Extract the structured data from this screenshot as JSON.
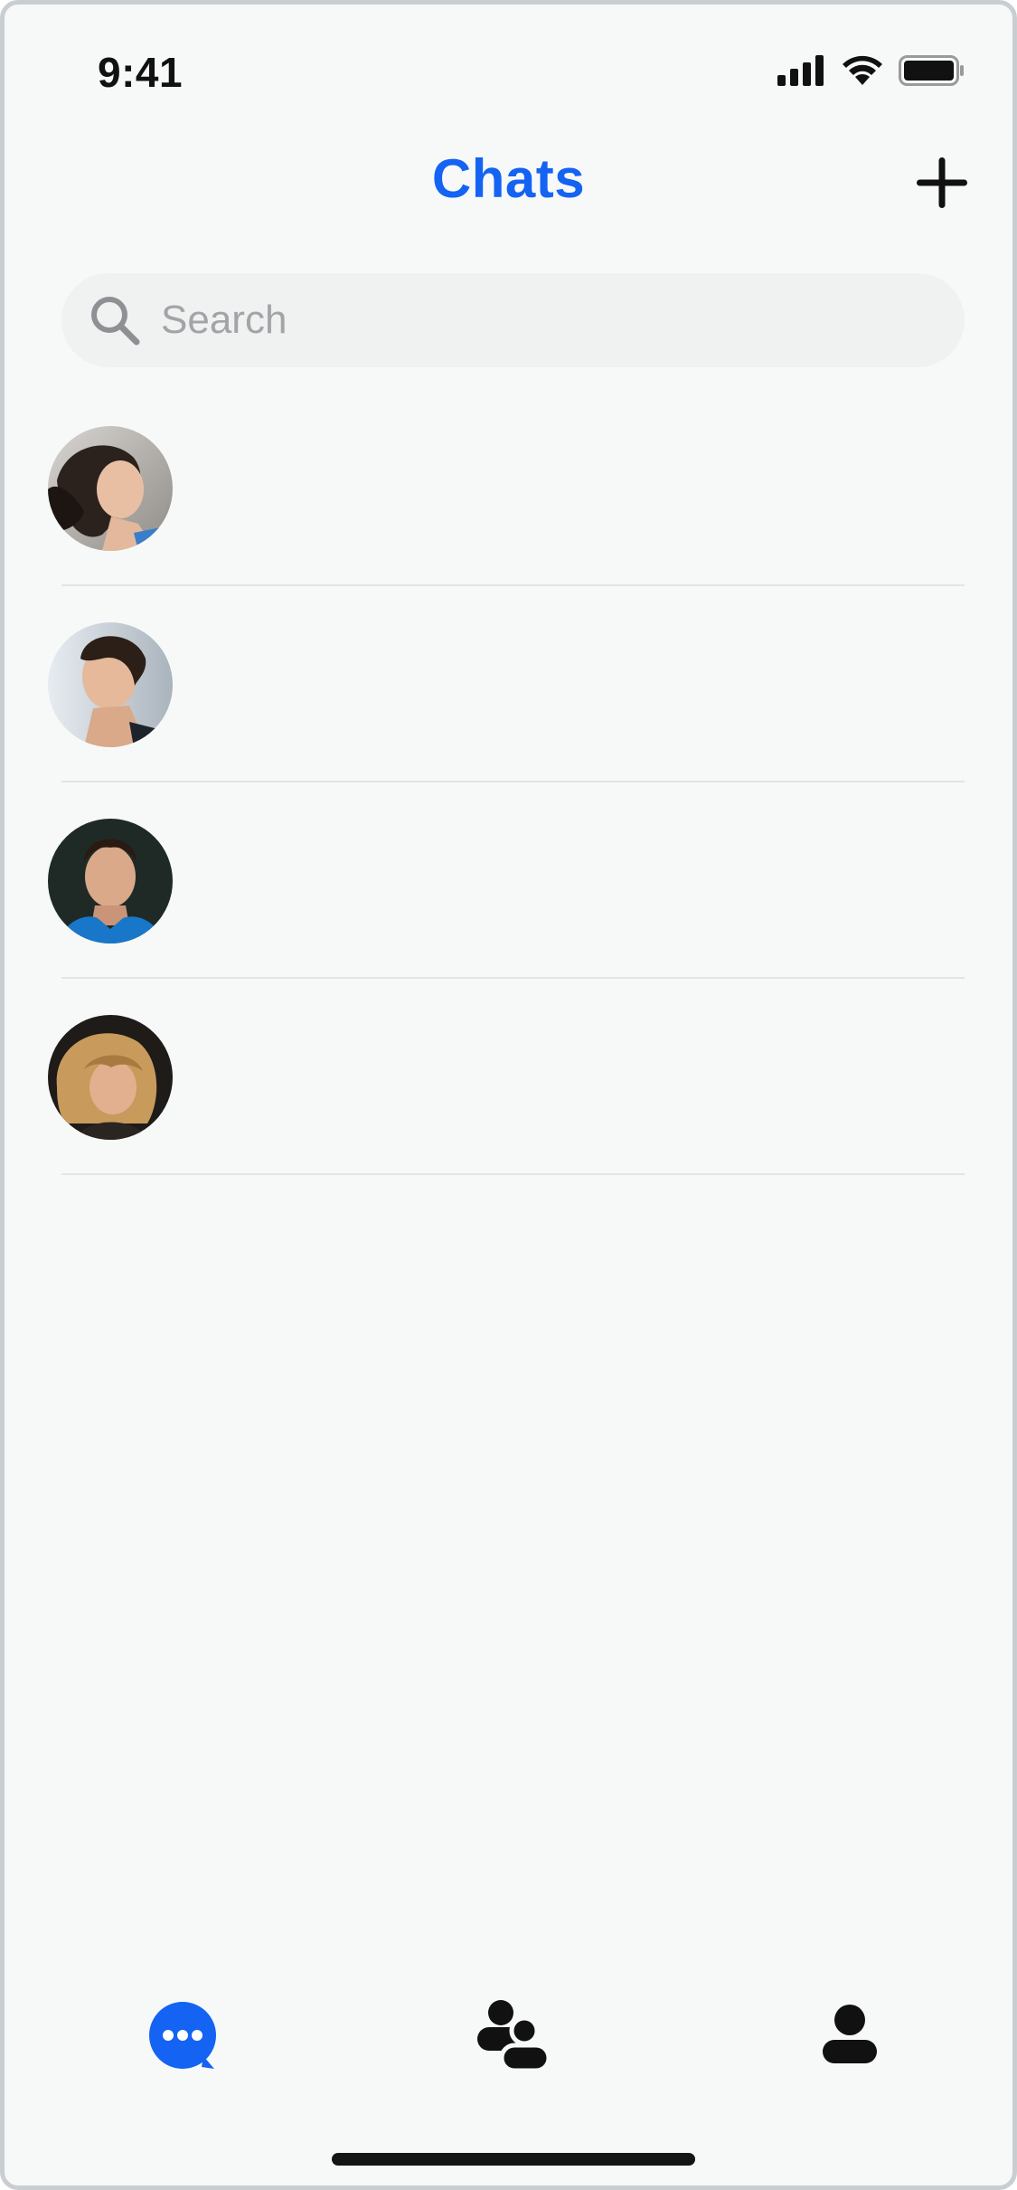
{
  "status_bar": {
    "time": "9:41"
  },
  "header": {
    "title": "Chats",
    "new_chat_icon": "plus-icon"
  },
  "search": {
    "placeholder": "Search",
    "value": "",
    "icon": "search-icon"
  },
  "chats": [
    {
      "avatar": "avatar-woman-dark-hair"
    },
    {
      "avatar": "avatar-man-looking-up"
    },
    {
      "avatar": "avatar-man-blue-jacket"
    },
    {
      "avatar": "avatar-woman-blonde"
    }
  ],
  "tab_bar": {
    "tabs": [
      {
        "icon": "chat-bubble-icon",
        "active": true
      },
      {
        "icon": "contacts-icon",
        "active": false
      },
      {
        "icon": "profile-icon",
        "active": false
      }
    ]
  },
  "colors": {
    "accent": "#1463f3",
    "background": "#f7f9f9",
    "search_bg": "#f0f1f1",
    "divider": "#e2e4e6",
    "placeholder": "#a2a5a8"
  }
}
